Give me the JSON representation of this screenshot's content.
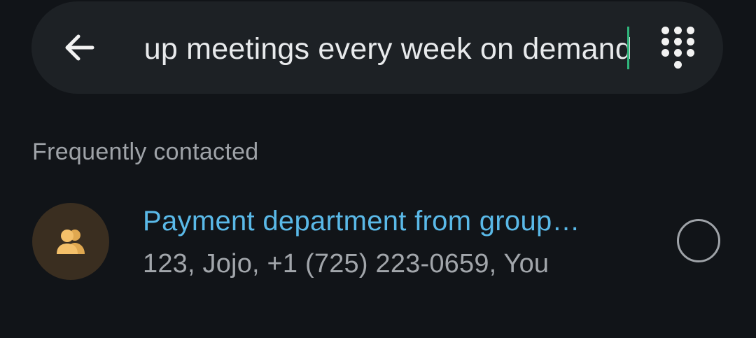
{
  "search": {
    "query": "up meetings every week on demand",
    "back_icon": "arrow-left-icon",
    "dialpad_icon": "dialpad-icon",
    "caret_color": "#2fb67c"
  },
  "section": {
    "title": "Frequently contacted"
  },
  "contacts": [
    {
      "name": "Payment department from group…",
      "details": "123, Jojo, +1 (725) 223-0659, You",
      "avatar_icon": "group-icon",
      "avatar_bg": "#3a2e20",
      "avatar_icon_color": "#f4c06a",
      "name_color": "#5ab9e8",
      "selected": false
    }
  ]
}
